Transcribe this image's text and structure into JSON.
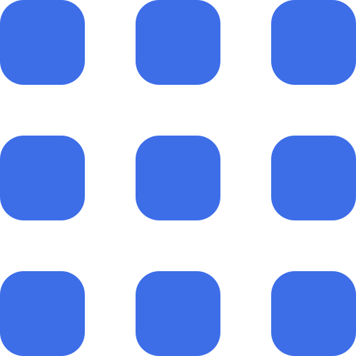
{
  "icon": {
    "name": "app-grid-icon",
    "color": "#3d6ee8",
    "rows": 3,
    "columns": 3
  }
}
